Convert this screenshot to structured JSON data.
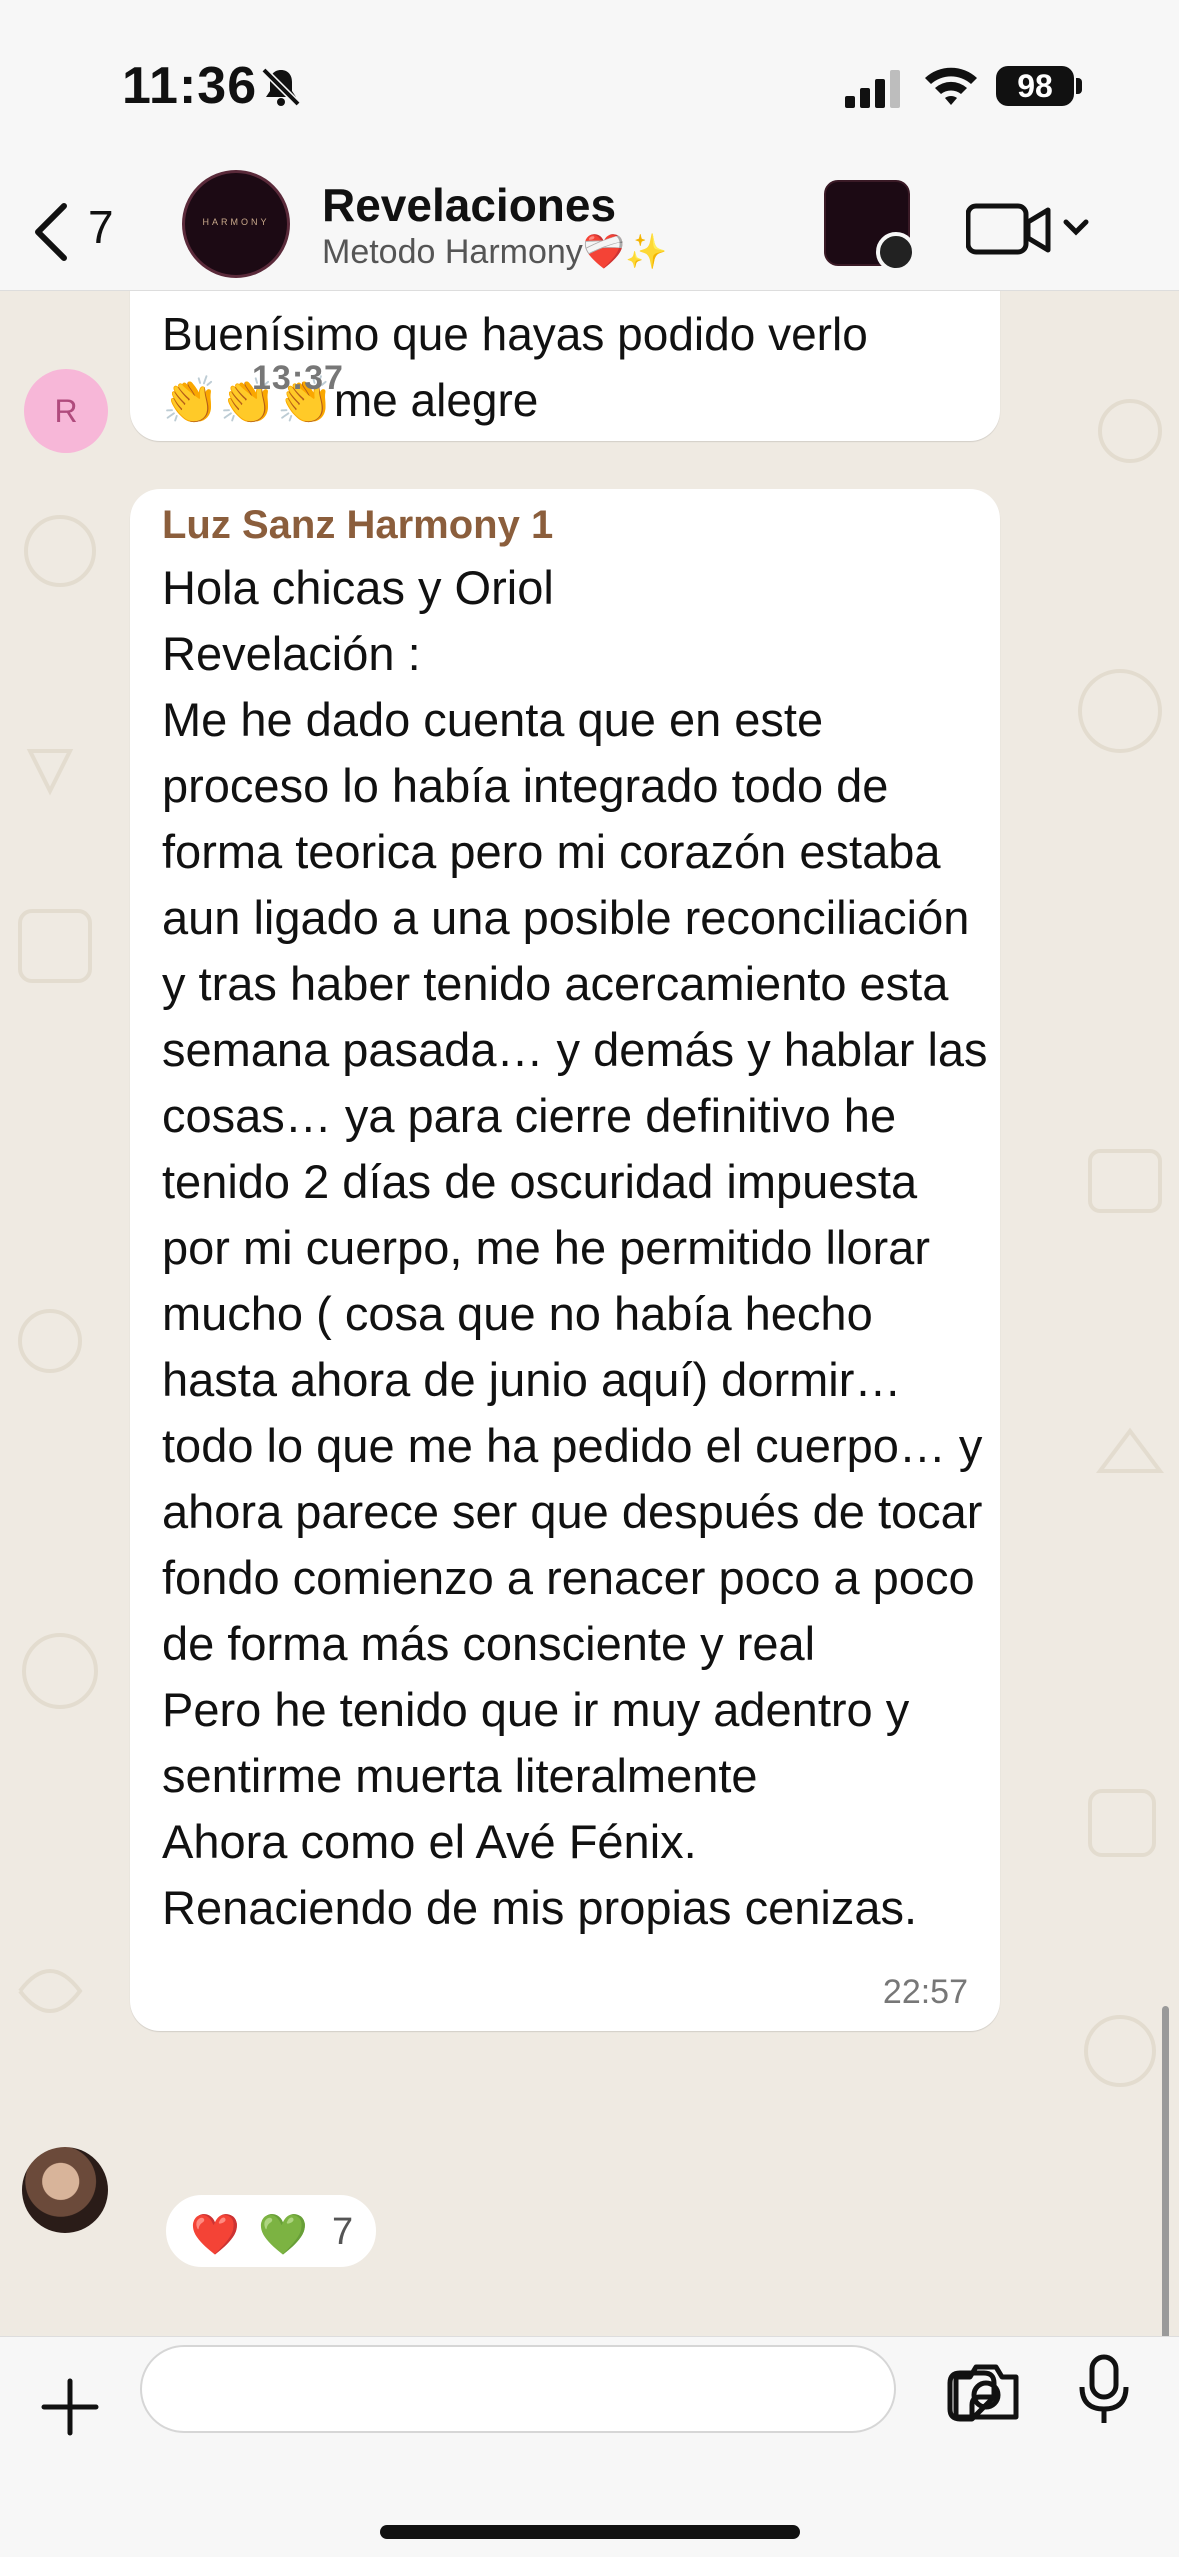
{
  "status_bar": {
    "time": "11:36",
    "battery": "98",
    "icons": [
      "bell-slash-icon",
      "signal-icon",
      "wifi-icon",
      "battery-icon"
    ]
  },
  "header": {
    "back_count": "7",
    "title": "Revelaciones",
    "subtitle": "Metodo Harmony",
    "subtitle_emoji": "❤️‍🩹✨",
    "avatar_text": "HARMONY",
    "icons": [
      "back-chevron-icon",
      "group-avatar",
      "video-call-icon",
      "chevron-down-icon"
    ]
  },
  "messages": [
    {
      "avatar_initial": "R",
      "text": "Buenísimo que hayas podido verlo",
      "emoji": "👏👏👏",
      "text_after_emoji": "me alegre",
      "time": "13:37"
    },
    {
      "sender": "Luz Sanz Harmony 1",
      "text": "Hola chicas y Oriol\nRevelación :\nMe he dado cuenta que en este proceso lo había integrado todo de forma teorica pero mi corazón estaba aun ligado a una posible reconciliación y tras haber tenido acercamiento esta semana pasada… y demás y hablar las cosas… ya para cierre definitivo he tenido 2 días de oscuridad impuesta por mi cuerpo, me he permitido llorar mucho ( cosa que no había hecho hasta ahora de junio aquí) dormir… todo lo que me ha pedido el cuerpo… y ahora parece ser que después de tocar fondo comienzo a renacer poco a poco de forma más consciente y real\nPero he tenido que ir muy adentro y sentirme muerta literalmente\nAhora como el Avé Fénix.\nRenaciendo de mis propias cenizas.",
      "time": "22:57",
      "reactions": {
        "emoji_1": "❤️",
        "emoji_2": "💚",
        "count": "7"
      }
    }
  ],
  "input_bar": {
    "placeholder": "",
    "icons": [
      "plus-icon",
      "sticker-icon",
      "camera-icon",
      "microphone-icon"
    ]
  },
  "colors": {
    "chat_bg": "#efeae2",
    "bubble": "#ffffff",
    "sender": "#8b5e3c",
    "bar_bg": "#f7f7f7"
  }
}
